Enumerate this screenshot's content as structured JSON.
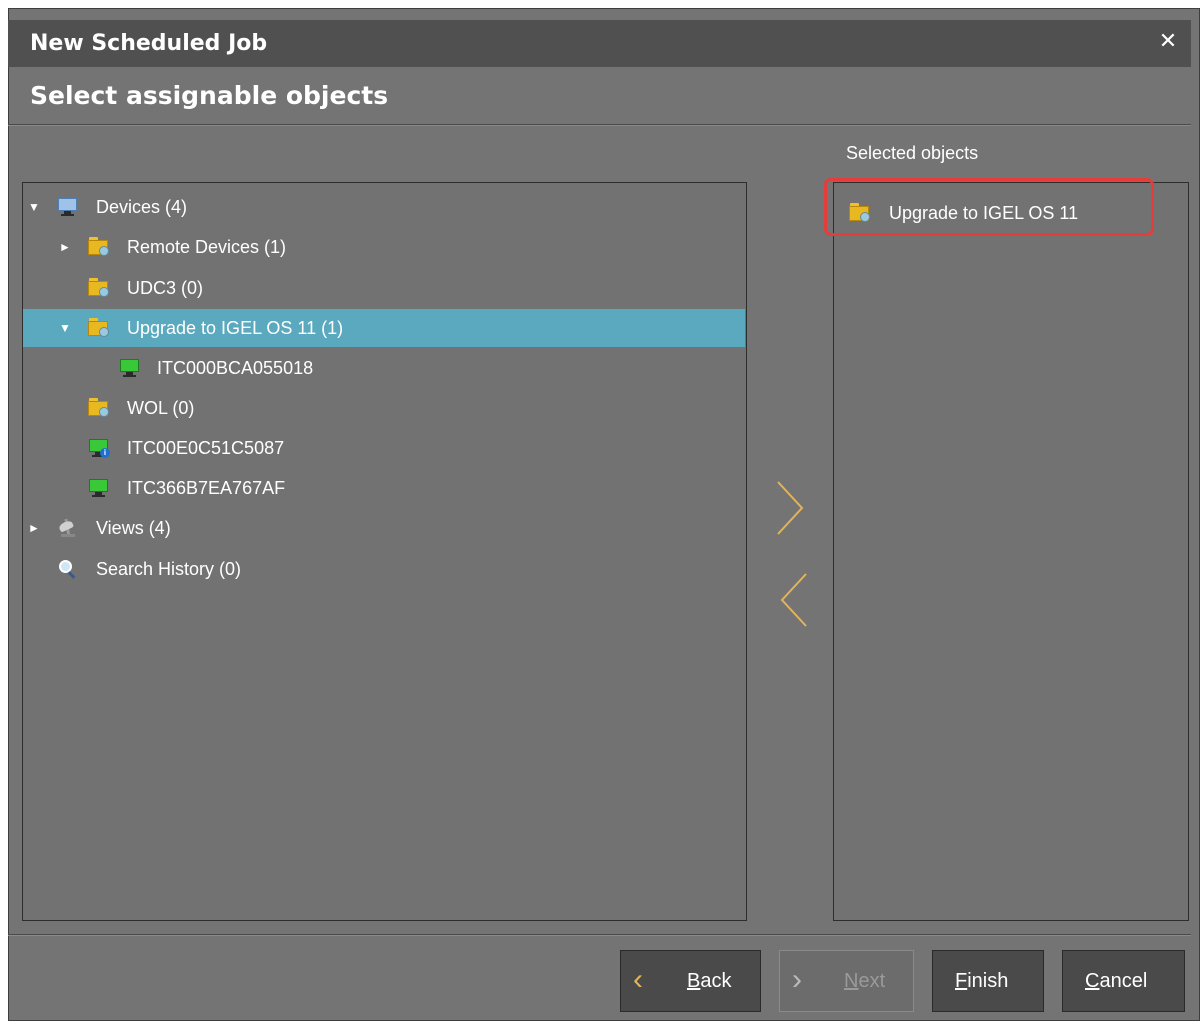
{
  "window": {
    "title": "New Scheduled Job",
    "close_label": "✕"
  },
  "page": {
    "section_title": "Select assignable objects"
  },
  "tree": {
    "items": [
      {
        "label": "Devices (4)",
        "icon": "monitor-blue-icon",
        "expanded": true
      },
      {
        "label": "Remote Devices (1)",
        "icon": "folder-icon",
        "expanded": false
      },
      {
        "label": "UDC3 (0)",
        "icon": "folder-icon"
      },
      {
        "label": "Upgrade to IGEL OS 11 (1)",
        "icon": "folder-icon",
        "expanded": true,
        "selected": true
      },
      {
        "label": "ITC000BCA055018",
        "icon": "monitor-icon"
      },
      {
        "label": "WOL (0)",
        "icon": "folder-icon"
      },
      {
        "label": "ITC00E0C51C5087",
        "icon": "monitor-info-icon"
      },
      {
        "label": "ITC366B7EA767AF",
        "icon": "monitor-icon"
      },
      {
        "label": "Views (4)",
        "icon": "views-icon",
        "expanded": false
      },
      {
        "label": "Search History (0)",
        "icon": "search-icon"
      }
    ]
  },
  "selected": {
    "header": "Selected objects",
    "items": [
      {
        "label": "Upgrade to IGEL OS 11",
        "icon": "folder-icon"
      }
    ]
  },
  "buttons": {
    "back": {
      "label_u": "B",
      "label_rest": "ack"
    },
    "next": {
      "label_u": "N",
      "label_rest": "ext"
    },
    "finish": {
      "label_u": "F",
      "label_rest": "inish"
    },
    "cancel": {
      "label_u": "C",
      "label_rest": "ancel"
    }
  },
  "colors": {
    "dialog_bg": "#747474",
    "titlebar_bg": "#505050",
    "selection": "#5aa9bf",
    "highlight": "#e53c3c",
    "accent_arrow": "#e3b35a"
  }
}
